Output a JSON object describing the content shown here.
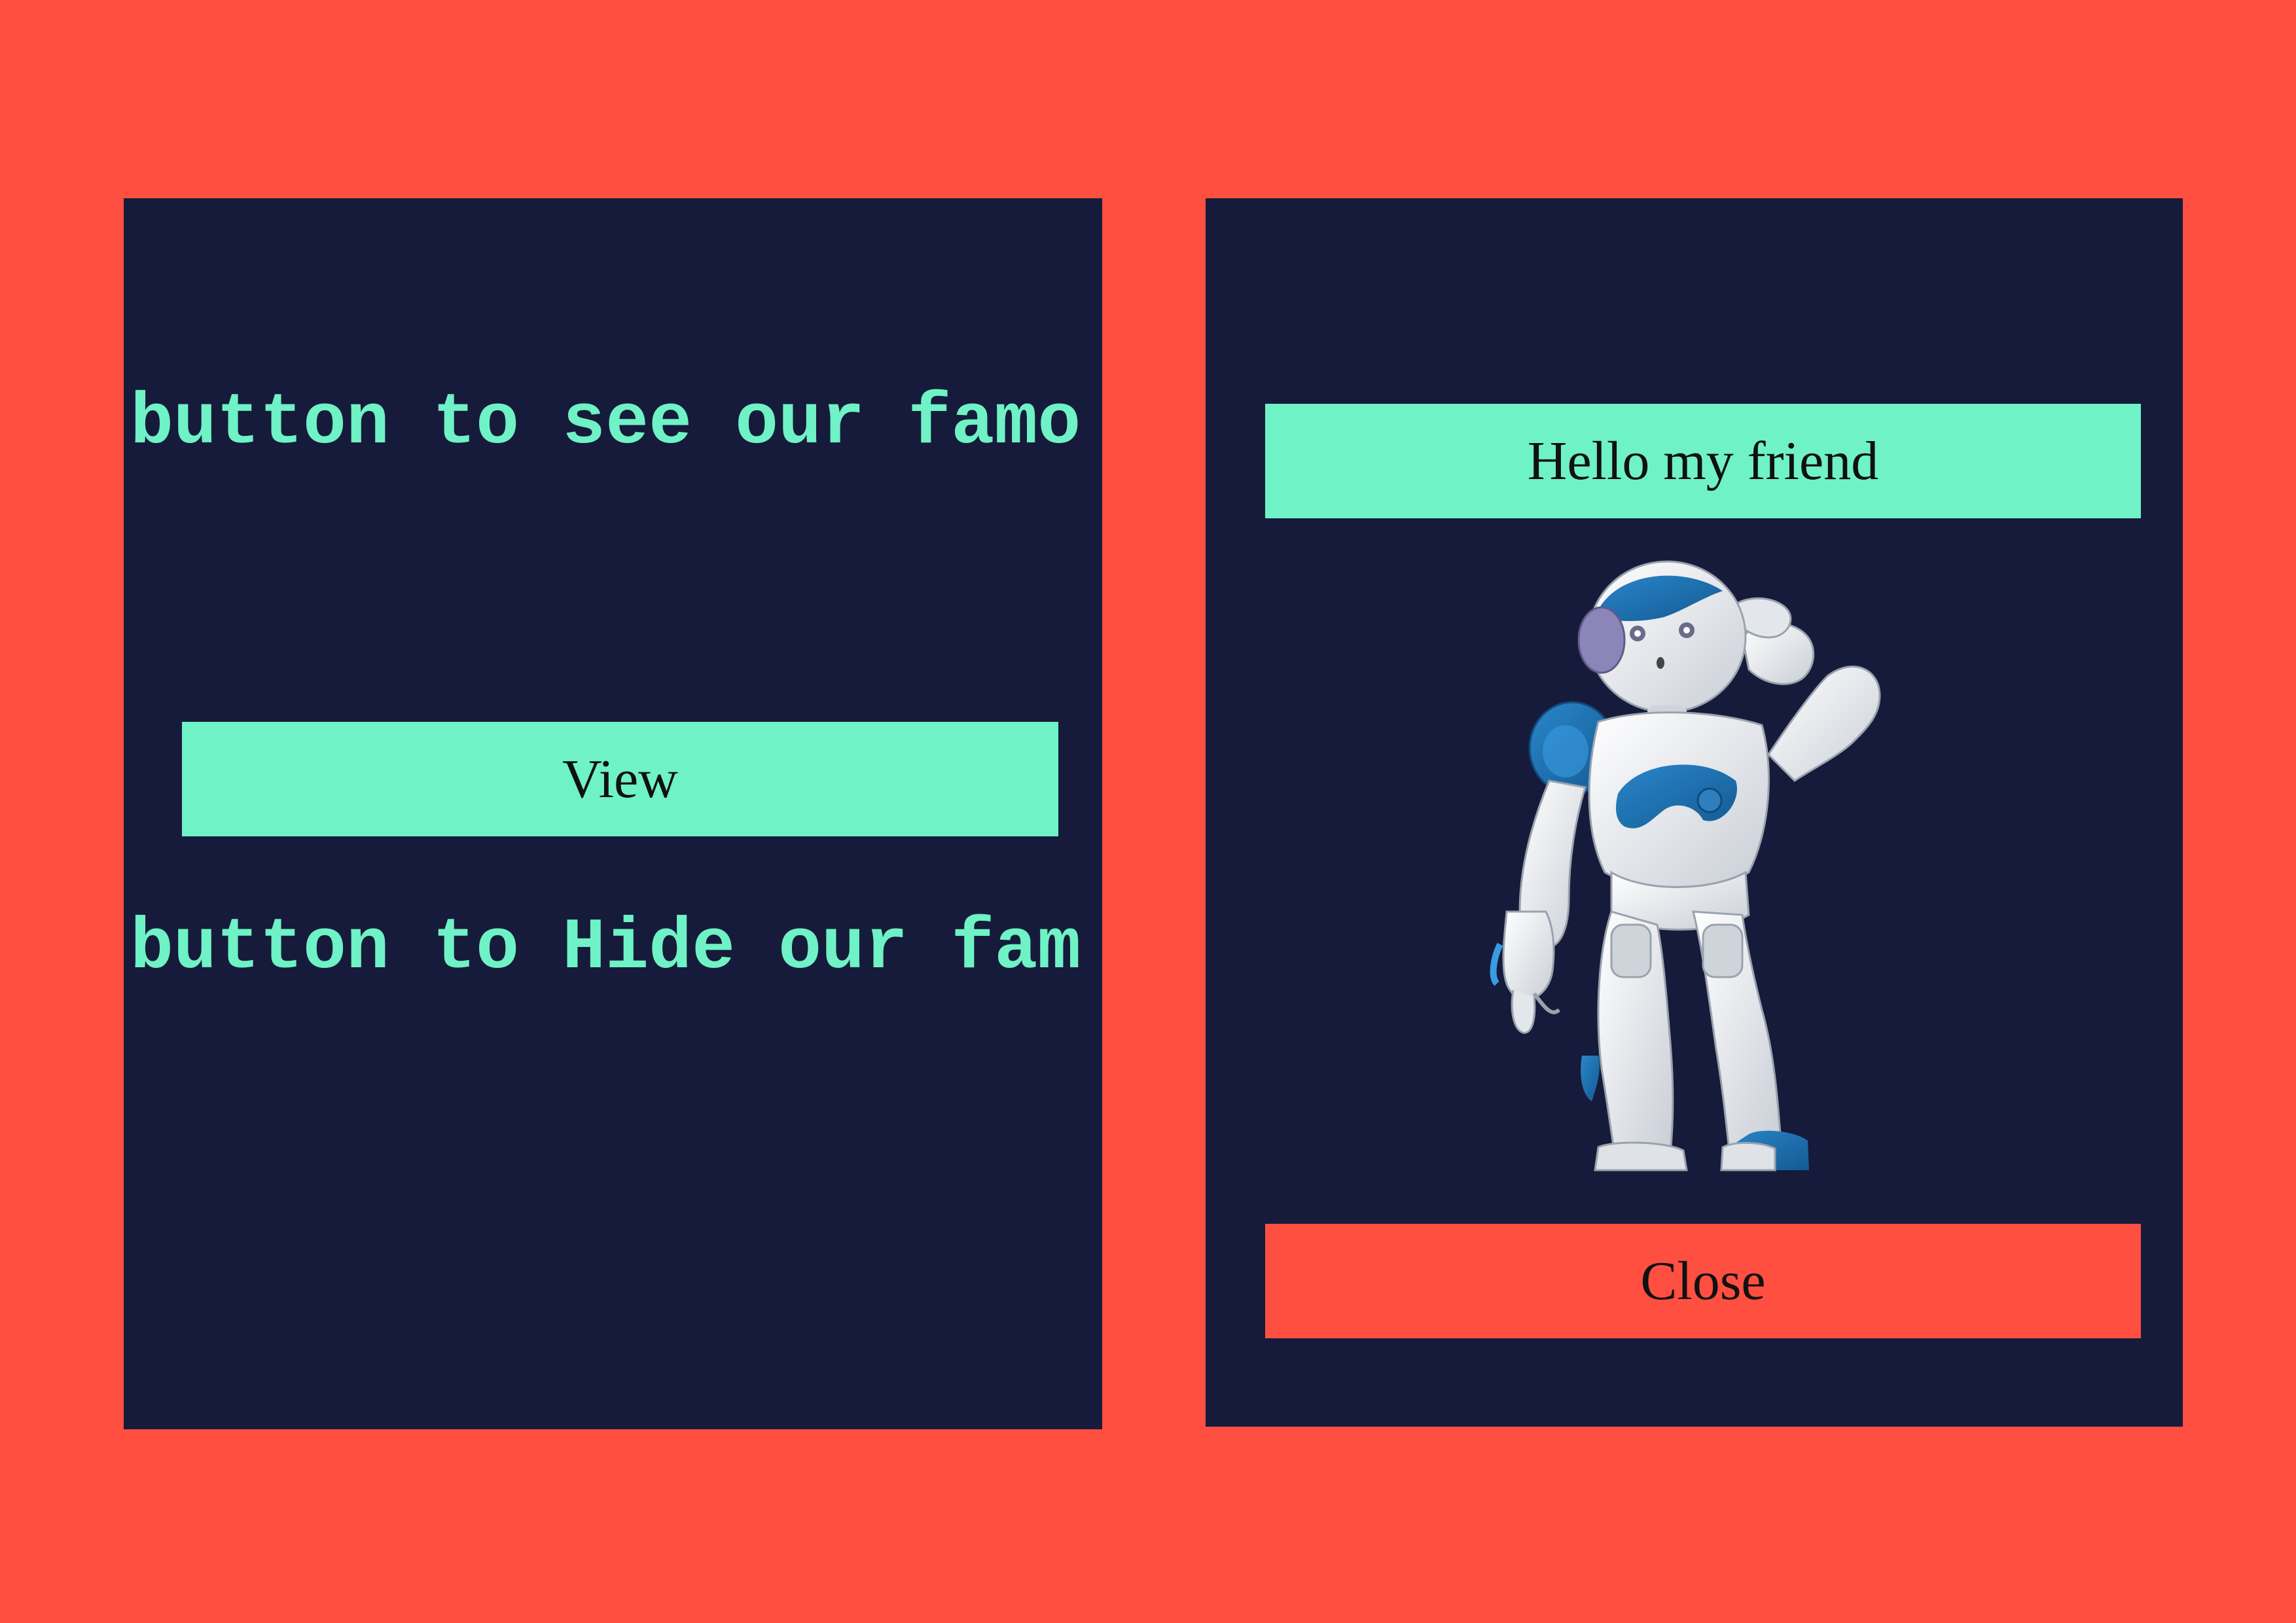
{
  "left_panel": {
    "marquee_top": "button to see our famo",
    "view_button_label": "View",
    "marquee_bottom": "button to Hide our fam"
  },
  "right_panel": {
    "greeting": "Hello my friend",
    "image_icon": "humanoid-robot-icon",
    "close_button_label": "Close"
  },
  "colors": {
    "background": "#ff4f40",
    "panel": "#161b3b",
    "accent": "#6ff2c5",
    "close_button": "#ff4f40",
    "robot_blue": "#1f6fb2",
    "robot_white": "#eef1f4"
  }
}
